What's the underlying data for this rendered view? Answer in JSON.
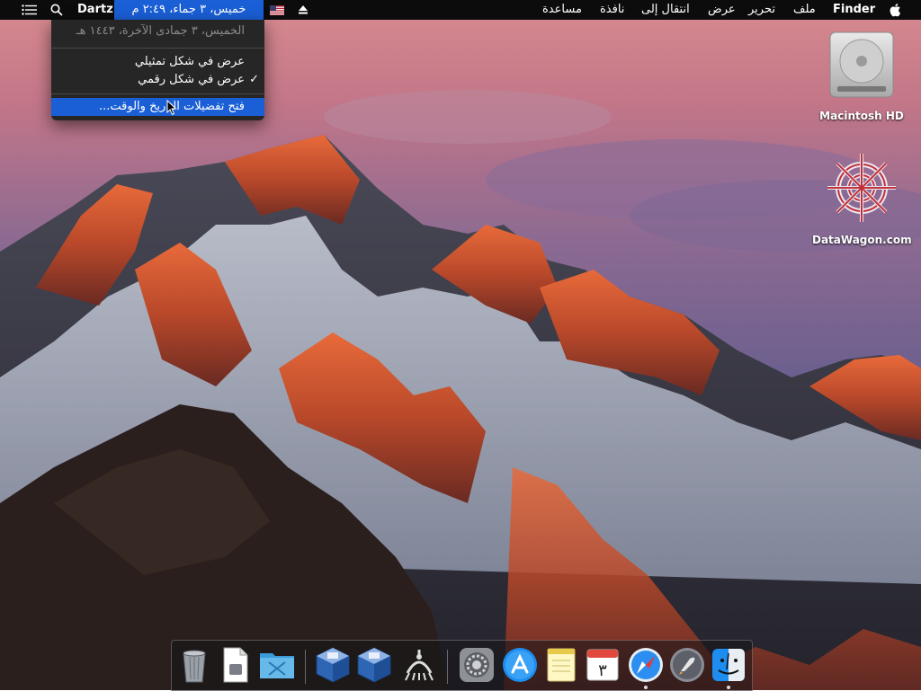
{
  "menubar": {
    "apple_icon": "apple-logo-icon",
    "app_name": "Finder",
    "menus": [
      "ملف",
      "تحرير",
      "عرض",
      "انتقال إلى",
      "نافذة",
      "مساعدة"
    ],
    "eject_icon": "eject-icon",
    "input_source_icon": "us-flag-icon",
    "clock": "خميس، ٣ جماء، ٢:٤٩ م",
    "user": "Dartz",
    "search_icon": "spotlight-search-icon",
    "notification_icon": "notification-center-icon"
  },
  "clock_menu": {
    "date_line": "الخميس، ٣ جمادى الآخرة، ١٤٤٣ هـ",
    "analog": "عرض في شكل تمثيلي",
    "digital": "عرض في شكل رقمي",
    "digital_checked": true,
    "check_mark": "✓",
    "open_prefs": "فتح تفضيلات التاريخ والوقت..."
  },
  "desktop_icons": [
    {
      "label": "Macintosh HD",
      "icon": "hard-drive-icon"
    },
    {
      "label": "DataWagon.com",
      "icon": "datawagon-logo-icon"
    }
  ],
  "dock": {
    "items": [
      "trash-icon",
      "document-icon",
      "folder-icon",
      "virtualbox-icon",
      "virtualbox-icon",
      "network-utility-icon",
      "system-preferences-icon",
      "app-store-icon",
      "notes-icon",
      "calendar-icon",
      "safari-icon",
      "launchpad-icon",
      "finder-icon"
    ],
    "calendar_day": "٣"
  },
  "colors": {
    "menu_bar": "#0c0c0c",
    "highlight": "#1a5fd6",
    "menu_bg": "#262626"
  }
}
